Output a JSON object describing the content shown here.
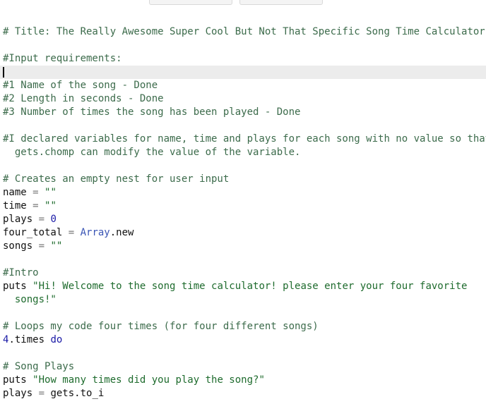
{
  "code": {
    "title": "# Title: The Really Awesome Super Cool But Not That Specific Song Time Calculator",
    "input_req": "#Input requirements:",
    "req1": "#1 Name of the song - Done",
    "req2": "#2 Length in seconds - Done",
    "req3": "#3 Number of times the song has been played - Done",
    "declared_1": "#I declared variables for name, time and plays for each song with no value so that",
    "declared_2": "  gets.chomp can modify the value of the variable.",
    "creates": "# Creates an empty nest for user input",
    "name_var": "name",
    "name_op": " = ",
    "name_val": "\"\"",
    "time_var": "time",
    "time_op": " = ",
    "time_val": "\"\"",
    "plays_var": "plays",
    "plays_op": " = ",
    "plays_val": "0",
    "four_var": "four_total",
    "four_op": " = ",
    "four_const": "Array",
    "four_method": ".new",
    "songs_var": "songs",
    "songs_op": " = ",
    "songs_val": "\"\"",
    "intro": "#Intro",
    "puts1_kw": "puts ",
    "puts1_str_1": "\"Hi! Welcome to the song time calculator! please enter your four favorite",
    "puts1_str_2": "  songs!\"",
    "loops": "# Loops my code four times (for four different songs)",
    "times_num": "4",
    "times_method": ".times ",
    "times_do": "do",
    "song_plays": "# Song Plays",
    "puts2_kw": "puts ",
    "puts2_str": "\"How many times did you play the song?\"",
    "plays2_var": "plays",
    "plays2_op": " = ",
    "plays2_val": "gets.to_i"
  },
  "colors": {
    "comment": "#3c6b4b",
    "string": "#1e6b2d",
    "number": "#1a1aa6",
    "constant": "#3a55b5",
    "active_line": "#ececec"
  }
}
